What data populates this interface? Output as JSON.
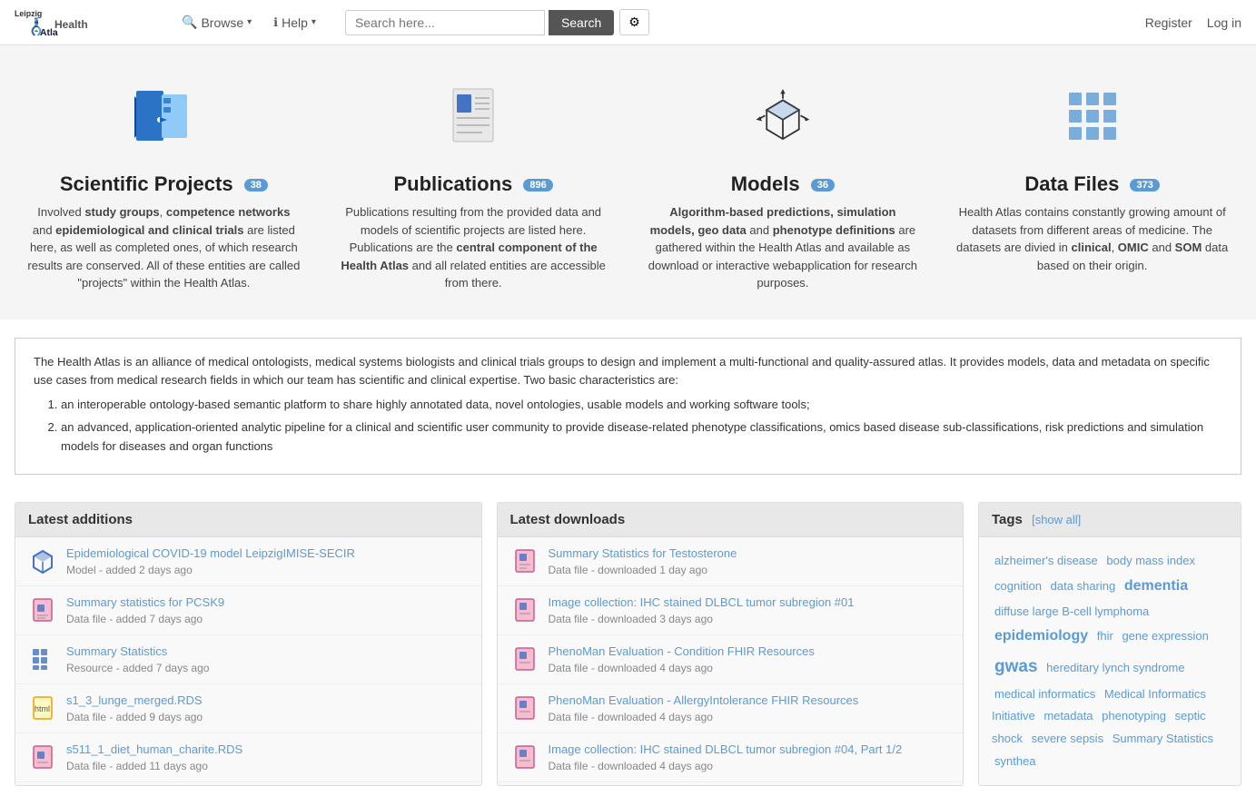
{
  "navbar": {
    "brand_top": "Leipzig",
    "brand_bottom": "Health Atlas",
    "browse_label": "Browse",
    "help_label": "Help",
    "search_placeholder": "Search here...",
    "search_btn": "Search",
    "gear_icon": "⚙",
    "register_label": "Register",
    "login_label": "Log in"
  },
  "hero": {
    "items": [
      {
        "id": "scientific-projects",
        "title": "Scientific Projects",
        "badge": "38",
        "desc_html": "Involved <strong>study groups</strong>, <strong>competence networks</strong> and <strong>epidemiological and clinical trials</strong> are listed here, as well as completed ones, of which research results are conserved. All of these entities are called \"projects\" within the Health Atlas."
      },
      {
        "id": "publications",
        "title": "Publications",
        "badge": "896",
        "desc_html": "Publications resulting from the provided data and models of scientific projects are listed here. Publications are the <strong>central component of the Health Atlas</strong> and all related entities are accessible from there."
      },
      {
        "id": "models",
        "title": "Models",
        "badge": "36",
        "desc_html": "<strong>Algorithm-based predictions, simulation models, geo data</strong> and <strong>phenotype definitions</strong> are gathered within the Health Atlas and available as download or interactive webapplication for research purposes."
      },
      {
        "id": "data-files",
        "title": "Data Files",
        "badge": "373",
        "desc_html": "Health Atlas contains constantly growing amount of datasets from different areas of medicine. The datasets are divied in <strong>clinical</strong>, <strong>OMIC</strong> and <strong>SOM</strong> data based on their origin."
      }
    ]
  },
  "info": {
    "intro": "The Health Atlas is an alliance of medical ontologists, medical systems biologists and clinical trials groups to design and implement a multi-functional and quality-assured atlas. It provides models, data and metadata on specific use cases from medical research fields in which our team has scientific and clinical expertise. Two basic characteristics are:",
    "points": [
      "an interoperable ontology-based semantic platform to share highly annotated data, novel ontologies, usable models and working software tools;",
      "an advanced, application-oriented analytic pipeline for a clinical and scientific user community to provide disease-related phenotype classifications, omics based disease sub-classifications, risk predictions and simulation models for diseases and organ functions"
    ]
  },
  "latest_additions": {
    "header": "Latest additions",
    "items": [
      {
        "title": "Epidemiological COVID-19 model LeipzigIMISE-SECIR",
        "sub": "Model - added 2 days ago",
        "icon": "cube"
      },
      {
        "title": "Summary statistics for PCSK9",
        "sub": "Data file - added 7 days ago",
        "icon": "file-pink"
      },
      {
        "title": "Summary Statistics",
        "sub": "Resource - added 7 days ago",
        "icon": "grid"
      },
      {
        "title": "s1_3_lunge_merged.RDS",
        "sub": "Data file - added 9 days ago",
        "icon": "file-yellow"
      },
      {
        "title": "s511_1_diet_human_charite.RDS",
        "sub": "Data file - added 11 days ago",
        "icon": "file-pink"
      }
    ]
  },
  "latest_downloads": {
    "header": "Latest downloads",
    "items": [
      {
        "title": "Summary Statistics for Testosterone",
        "sub": "Data file - downloaded 1 day ago",
        "icon": "file-pink"
      },
      {
        "title": "Image collection: IHC stained DLBCL tumor subregion #01",
        "sub": "Data file - downloaded 3 days ago",
        "icon": "file-pink"
      },
      {
        "title": "PhenoMan Evaluation - Condition FHIR Resources",
        "sub": "Data file - downloaded 4 days ago",
        "icon": "file-pink"
      },
      {
        "title": "PhenoMan Evaluation - AllergyIntolerance FHIR Resources",
        "sub": "Data file - downloaded 4 days ago",
        "icon": "file-pink"
      },
      {
        "title": "Image collection: IHC stained DLBCL tumor subregion #04, Part 1/2",
        "sub": "Data file - downloaded 4 days ago",
        "icon": "file-pink"
      }
    ]
  },
  "tags": {
    "header": "Tags",
    "show_all": "[show all]",
    "items": [
      {
        "label": "alzheimer's disease",
        "size": "small"
      },
      {
        "label": "body mass index",
        "size": "small"
      },
      {
        "label": "cognition",
        "size": "small"
      },
      {
        "label": "data sharing",
        "size": "small"
      },
      {
        "label": "dementia",
        "size": "large"
      },
      {
        "label": "diffuse large B-cell lymphoma",
        "size": "small"
      },
      {
        "label": "epidemiology",
        "size": "large"
      },
      {
        "label": "fhir",
        "size": "small"
      },
      {
        "label": "gene expression",
        "size": "small"
      },
      {
        "label": "gwas",
        "size": "xlarge"
      },
      {
        "label": "hereditary lynch syndrome",
        "size": "small"
      },
      {
        "label": "medical informatics",
        "size": "small"
      },
      {
        "label": "Medical Informatics Initiative",
        "size": "small"
      },
      {
        "label": "metadata",
        "size": "small"
      },
      {
        "label": "phenotyping",
        "size": "small"
      },
      {
        "label": "septic shock",
        "size": "small"
      },
      {
        "label": "severe sepsis",
        "size": "small"
      },
      {
        "label": "Summary Statistics",
        "size": "small"
      },
      {
        "label": "synthea",
        "size": "small"
      }
    ]
  }
}
